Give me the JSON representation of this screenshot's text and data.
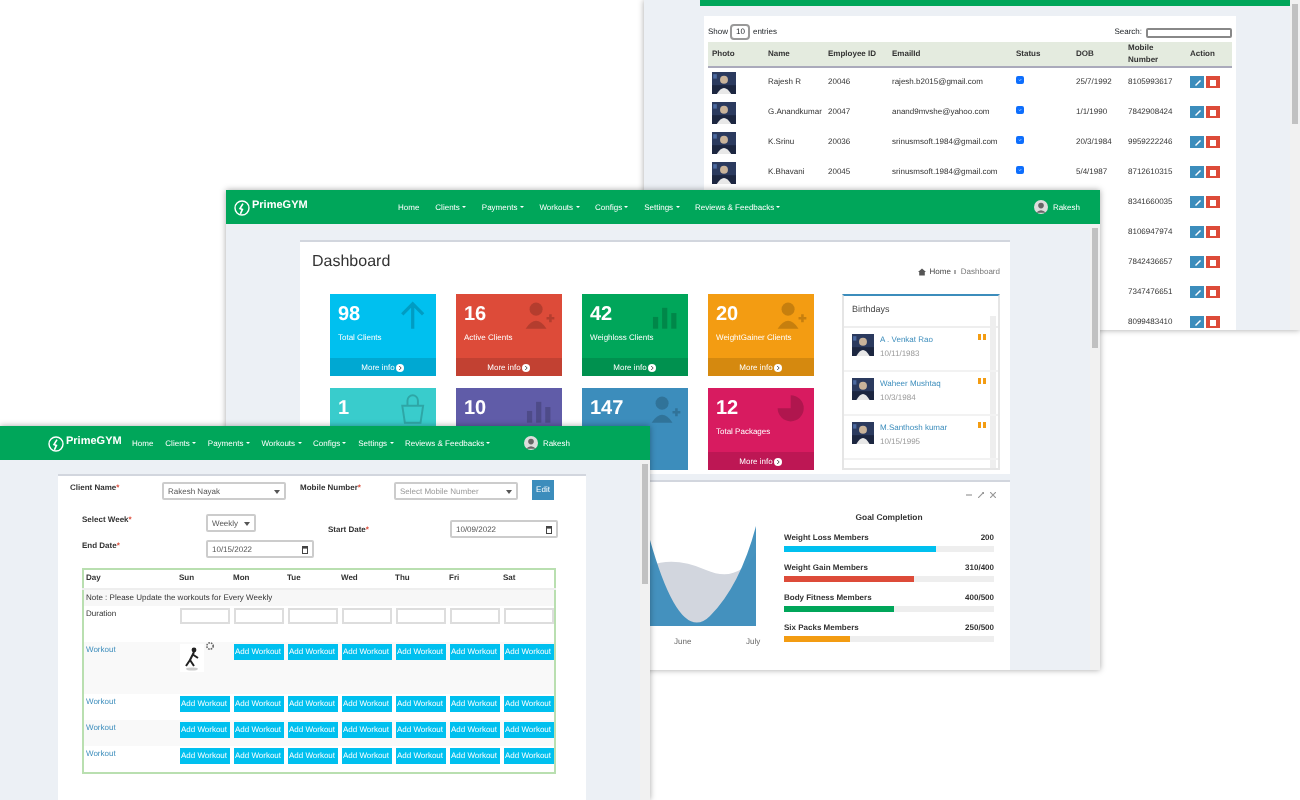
{
  "clients_window": {
    "show_label": "Show",
    "show_value": "10",
    "entries_label": "entries",
    "search_label": "Search:",
    "columns": [
      "Photo",
      "Name",
      "Employee ID",
      "EmailId",
      "Status",
      "DOB",
      "Mobile Number",
      "Action"
    ],
    "rows": [
      {
        "name": "Rajesh R",
        "employee_id": "20046",
        "email": "rajesh.b2015@gmail.com",
        "active": true,
        "dob": "25/7/1992",
        "mobile": "8105993617"
      },
      {
        "name": "G.Anandkumar",
        "employee_id": "20047",
        "email": "anand9mvshe@yahoo.com",
        "active": true,
        "dob": "1/1/1990",
        "mobile": "7842908424"
      },
      {
        "name": "K.Srinu",
        "employee_id": "20036",
        "email": "srinusmsoft.1984@gmail.com",
        "active": true,
        "dob": "20/3/1984",
        "mobile": "9959222246"
      },
      {
        "name": "K.Bhavani",
        "employee_id": "20045",
        "email": "srinusmsoft.1984@gmail.com",
        "active": true,
        "dob": "5/4/1987",
        "mobile": "8712610315"
      },
      {
        "mobile": "8341660035"
      },
      {
        "mobile": "8106947974"
      },
      {
        "mobile": "7842436657"
      },
      {
        "mobile": "7347476651"
      },
      {
        "mobile": "8099483410"
      }
    ]
  },
  "dashboard_window": {
    "brand": "PrimeGYM",
    "nav": [
      {
        "label": "Home",
        "dropdown": false
      },
      {
        "label": "Clients",
        "dropdown": true
      },
      {
        "label": "Payments",
        "dropdown": true
      },
      {
        "label": "Workouts",
        "dropdown": true
      },
      {
        "label": "Configs",
        "dropdown": true
      },
      {
        "label": "Settings",
        "dropdown": true
      },
      {
        "label": "Reviews & Feedbacks",
        "dropdown": true
      }
    ],
    "user": "Rakesh",
    "page_title": "Dashboard",
    "breadcrumb": [
      "Home",
      "Dashboard"
    ],
    "stats": [
      {
        "value": "98",
        "label": "Total Clients",
        "footer": "More info",
        "color": "#00c0ef",
        "kind": "arrow"
      },
      {
        "value": "16",
        "label": "Active Clients",
        "footer": "More info",
        "color": "#dd4b39",
        "kind": "person"
      },
      {
        "value": "42",
        "label": "Weighloss Clients",
        "footer": "More info",
        "color": "#00a65a",
        "kind": "bars"
      },
      {
        "value": "20",
        "label": "WeightGainer Clients",
        "footer": "More info",
        "color": "#f39c12",
        "kind": "person"
      },
      {
        "value": "1",
        "color": "#39cccc",
        "kind": "bag"
      },
      {
        "value": "10",
        "color": "#605ca8",
        "kind": "bars"
      },
      {
        "value": "147",
        "color": "#3c8dbc",
        "kind": "person"
      },
      {
        "value": "12",
        "label": "Total Packages",
        "footer": "More info",
        "color": "#d81b60",
        "kind": "pie"
      }
    ],
    "birthdays": {
      "title": "Birthdays",
      "people": [
        {
          "name": "A . Venkat Rao",
          "date": "10/11/1983"
        },
        {
          "name": "Waheer Mushtaq",
          "date": "10/3/1984"
        },
        {
          "name": "M.Santhosh kumar",
          "date": "10/15/1995"
        }
      ]
    },
    "chart_labels": [
      "June",
      "July"
    ],
    "goals": {
      "title": "Goal Completion",
      "items": [
        {
          "label": "Weight Loss Members",
          "value": "200",
          "level": 0.72,
          "color": "#00c0ef"
        },
        {
          "label": "Weight Gain Members",
          "value": "310/400",
          "level": 0.62,
          "color": "#dd4b39"
        },
        {
          "label": "Body Fitness Members",
          "value": "400/500",
          "level": 0.52,
          "color": "#00a65a"
        },
        {
          "label": "Six Packs Members",
          "value": "250/500",
          "level": 0.31,
          "color": "#f39c12"
        }
      ]
    }
  },
  "workout_window": {
    "brand": "PrimeGYM",
    "nav": [
      {
        "label": "Home",
        "dropdown": false
      },
      {
        "label": "Clients",
        "dropdown": true
      },
      {
        "label": "Payments",
        "dropdown": true
      },
      {
        "label": "Workouts",
        "dropdown": true
      },
      {
        "label": "Configs",
        "dropdown": true
      },
      {
        "label": "Settings",
        "dropdown": true
      },
      {
        "label": "Reviews & Feedbacks",
        "dropdown": true
      }
    ],
    "user": "Rakesh",
    "required_mark": "*",
    "client_name": {
      "label": "Client Name",
      "value": "Rakesh Nayak"
    },
    "mobile_number": {
      "label": "Mobile Number",
      "placeholder": "Select Mobile Number"
    },
    "edit_button": "Edit",
    "select_week": {
      "label": "Select Week",
      "value": "Weekly"
    },
    "start_date": {
      "label": "Start Date",
      "value": "10/09/2022"
    },
    "end_date": {
      "label": "End Date",
      "value": "10/15/2022"
    },
    "days": [
      "Day",
      "Sun",
      "Mon",
      "Tue",
      "Wed",
      "Thu",
      "Fri",
      "Sat"
    ],
    "note": "Note : Please Update the workouts for Every Weekly",
    "duration_label": "Duration",
    "workout_rows": [
      {
        "label": "Workout",
        "has_image": true,
        "buttons": [
          "Add Workout",
          "Add Workout",
          "Add Workout",
          "Add Workout",
          "Add Workout",
          "Add Workout"
        ]
      },
      {
        "label": "Workout",
        "has_image": false,
        "buttons": [
          "Add Workout",
          "Add Workout",
          "Add Workout",
          "Add Workout",
          "Add Workout",
          "Add Workout",
          "Add Workout"
        ]
      },
      {
        "label": "Workout",
        "has_image": false,
        "buttons": [
          "Add Workout",
          "Add Workout",
          "Add Workout",
          "Add Workout",
          "Add Workout",
          "Add Workout",
          "Add Workout"
        ]
      },
      {
        "label": "Workout",
        "has_image": false,
        "buttons": [
          "Add Workout",
          "Add Workout",
          "Add Workout",
          "Add Workout",
          "Add Workout",
          "Add Workout",
          "Add Workout"
        ]
      }
    ]
  }
}
